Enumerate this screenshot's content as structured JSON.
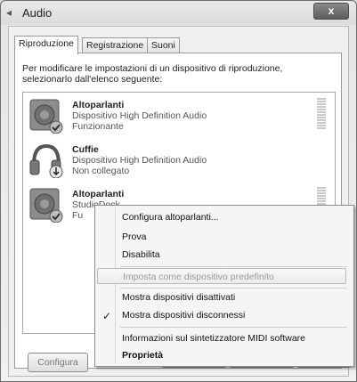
{
  "window": {
    "title": "Audio",
    "close_label": "x"
  },
  "tabs": [
    {
      "label": "Riproduzione",
      "active": true
    },
    {
      "label": "Registrazione",
      "active": false
    },
    {
      "label": "Suoni",
      "active": false
    }
  ],
  "intro": "Per modificare le impostazioni di un dispositivo di riproduzione, selezionarlo dall'elenco seguente:",
  "devices": [
    {
      "name": "Altoparlanti",
      "description": "Dispositivo High Definition Audio",
      "status": "Funzionante",
      "icon": "speaker-icon",
      "badge": "check-badge-icon"
    },
    {
      "name": "Cuffie",
      "description": "Dispositivo High Definition Audio",
      "status": "Non collegato",
      "icon": "headphones-icon",
      "badge": "down-arrow-badge-icon"
    },
    {
      "name": "Altoparlanti",
      "description": "StudioDock",
      "status": "Fu",
      "icon": "speaker-icon",
      "badge": "check-badge-icon"
    }
  ],
  "buttons": {
    "configura": "Configura"
  },
  "context_menu": {
    "items": [
      {
        "label": "Configura altoparlanti...",
        "state": "normal"
      },
      {
        "label": "Prova",
        "state": "normal"
      },
      {
        "label": "Disabilita",
        "state": "normal"
      },
      {
        "label": "Imposta come dispositivo predefinito",
        "state": "disabled"
      },
      {
        "label": "Mostra dispositivi disattivati",
        "state": "normal"
      },
      {
        "label": "Mostra dispositivi disconnessi",
        "state": "checked"
      },
      {
        "label": "Informazioni sul sintetizzatore MIDI software",
        "state": "normal"
      },
      {
        "label": "Proprietà",
        "state": "bold"
      }
    ],
    "check_glyph": "✓"
  }
}
